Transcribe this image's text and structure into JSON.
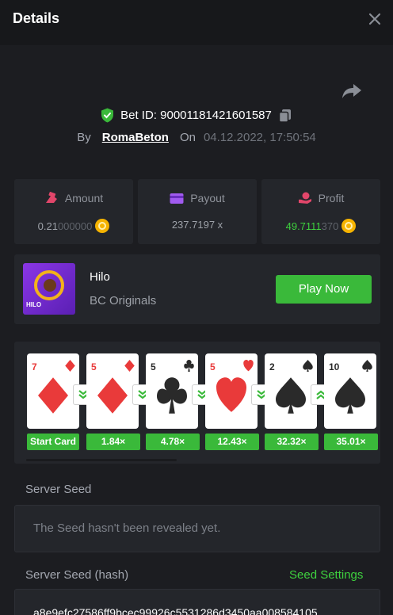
{
  "header": {
    "title": "Details"
  },
  "bet": {
    "id_text": "Bet ID: 90001181421601587",
    "by_label": "By",
    "user": "RomaBeton",
    "on_label": "On",
    "date": "04.12.2022, 17:50:54"
  },
  "stats": {
    "amount": {
      "label": "Amount",
      "value_main": "0.21",
      "value_dim": "000000"
    },
    "payout": {
      "label": "Payout",
      "value": "237.7197 x"
    },
    "profit": {
      "label": "Profit",
      "value_main": "49.7111",
      "value_dim": "370"
    }
  },
  "game": {
    "thumb_label": "HILO",
    "name": "Hilo",
    "provider": "BC Originals",
    "play_label": "Play Now"
  },
  "cards": [
    {
      "rank": "7",
      "suit": "diamond",
      "color": "red",
      "multiplier": "Start Card",
      "arrow": "down"
    },
    {
      "rank": "5",
      "suit": "diamond",
      "color": "red",
      "multiplier": "1.84×",
      "arrow": "down"
    },
    {
      "rank": "5",
      "suit": "club",
      "color": "black",
      "multiplier": "4.78×",
      "arrow": "down"
    },
    {
      "rank": "5",
      "suit": "heart",
      "color": "red",
      "multiplier": "12.43×",
      "arrow": "down"
    },
    {
      "rank": "2",
      "suit": "spade",
      "color": "black",
      "multiplier": "32.32×",
      "arrow": "up"
    },
    {
      "rank": "10",
      "suit": "spade",
      "color": "black",
      "multiplier": "35.01×",
      "arrow": null
    }
  ],
  "seed": {
    "server_seed_label": "Server Seed",
    "server_seed_value": "The Seed hasn't been revealed yet.",
    "hash_label": "Server Seed (hash)",
    "settings_label": "Seed Settings",
    "hash_value": "a8e9efc27586ff9bcec99926c5531286d3450aa008584105"
  },
  "colors": {
    "accent": "#3ab93a",
    "background": "#1c1d21",
    "panel": "#24262b"
  }
}
